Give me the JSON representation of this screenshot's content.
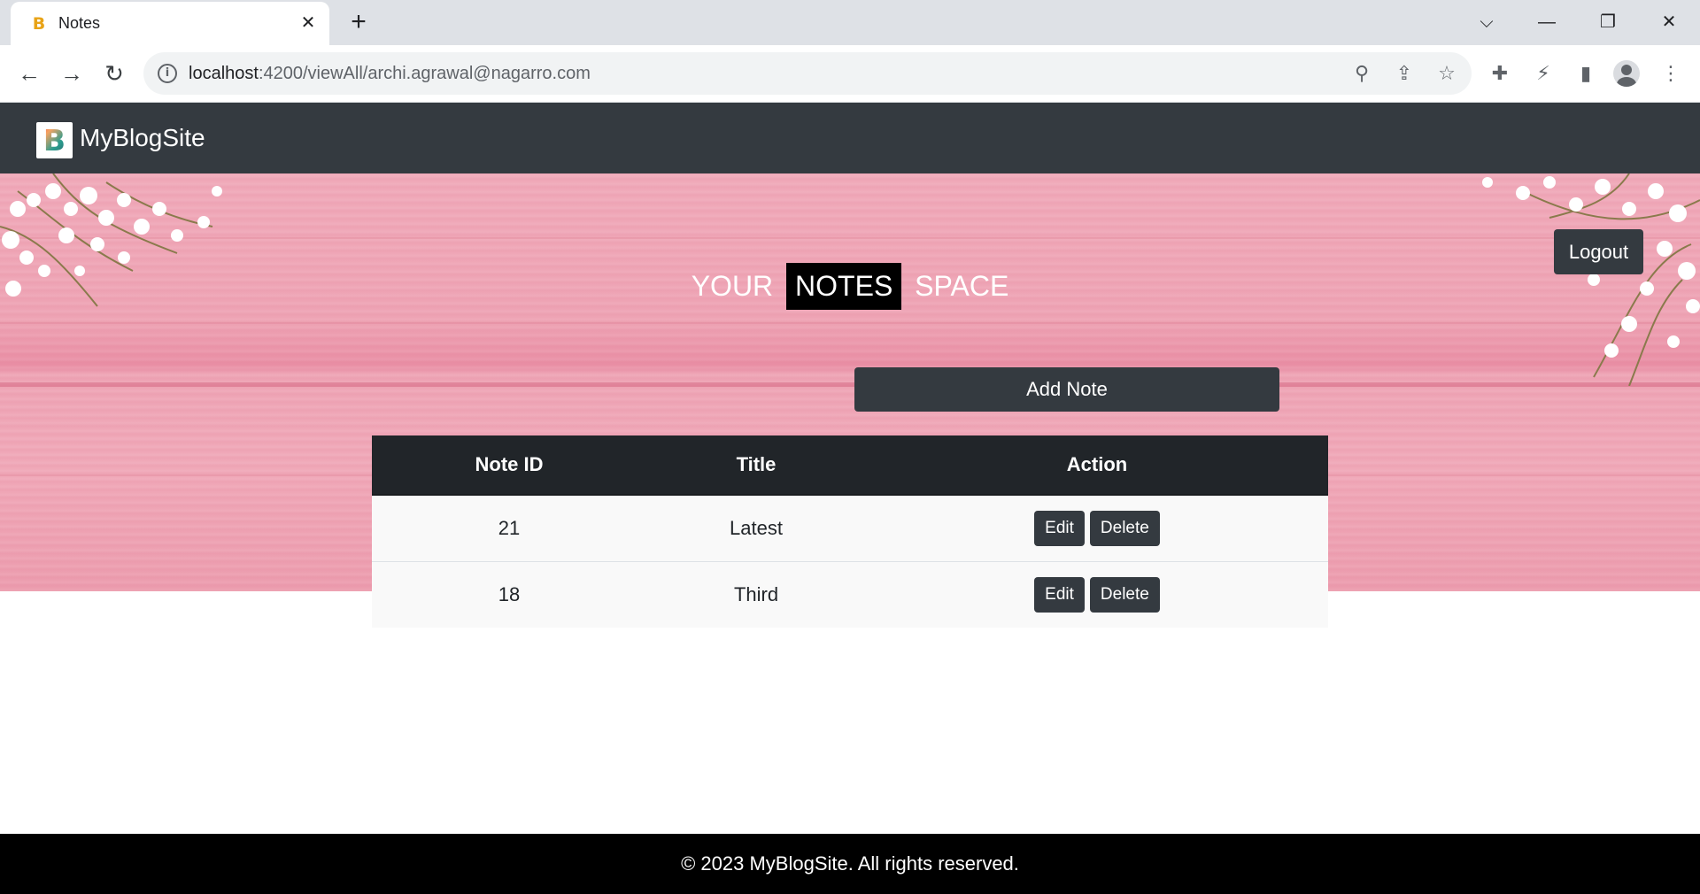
{
  "browser": {
    "tab_title": "Notes",
    "favicon_letter": "B",
    "close_glyph": "✕",
    "new_tab_glyph": "+",
    "url_host": "localhost",
    "url_path": ":4200/viewAll/archi.agrawal@nagarro.com",
    "info_glyph": "i",
    "controls": {
      "tab_list": "⌵",
      "minimize": "—",
      "restore": "❐",
      "close": "✕"
    },
    "nav": {
      "back": "←",
      "forward": "→",
      "reload": "↻"
    },
    "omni_icons": {
      "zoom": "⚲",
      "share": "⇪",
      "bookmark": "☆"
    },
    "ext_icons": {
      "extensions": "✚",
      "performance": "⚡",
      "side_panel": "▮",
      "menu": "⋮"
    }
  },
  "navbar": {
    "brand_logo_letter": "B",
    "brand_name": "MyBlogSite"
  },
  "header": {
    "logout_label": "Logout",
    "heading_pre": "YOUR",
    "heading_highlight": "NOTES",
    "heading_post": "SPACE"
  },
  "actions": {
    "add_note_label": "Add Note"
  },
  "table": {
    "columns": [
      "Note ID",
      "Title",
      "Action"
    ],
    "rows": [
      {
        "id": "21",
        "title": "Latest",
        "edit": "Edit",
        "delete": "Delete"
      },
      {
        "id": "18",
        "title": "Third",
        "edit": "Edit",
        "delete": "Delete"
      }
    ]
  },
  "footer": {
    "text": "© 2023 MyBlogSite. All rights reserved."
  },
  "colors": {
    "navbar": "#343a40",
    "table_header": "#212529",
    "hero_pink": "#f0a9b9",
    "footer": "#000000"
  }
}
